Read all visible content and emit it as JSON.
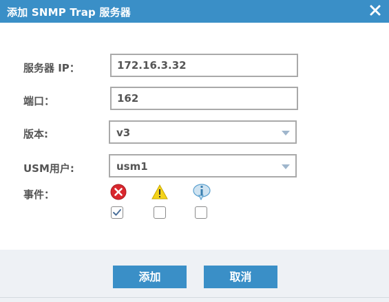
{
  "dialog": {
    "title": "添加 SNMP Trap 服务器"
  },
  "form": {
    "server_ip_label": "服务器 IP：",
    "server_ip_value": "172.16.3.32",
    "port_label": "端口：",
    "port_value": "162",
    "version_label": "版本:",
    "version_value": "v3",
    "usm_user_label": "USM用户:",
    "usm_user_value": "usm1",
    "events_label": "事件：",
    "events": [
      {
        "icon": "error-icon",
        "checked": true
      },
      {
        "icon": "warning-icon",
        "checked": false
      },
      {
        "icon": "info-icon",
        "checked": false
      }
    ]
  },
  "buttons": {
    "add_label": "添加",
    "cancel_label": "取消"
  },
  "colors": {
    "accent": "#3a8fc7",
    "error": "#d9272e",
    "warning": "#f4d31a",
    "info": "#5aa0cf"
  }
}
